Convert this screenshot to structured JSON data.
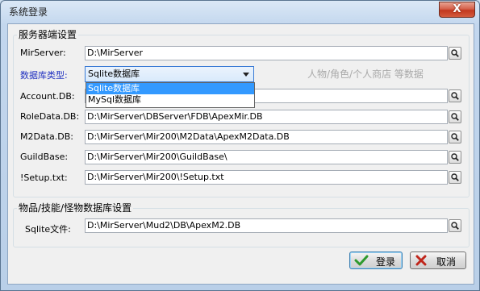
{
  "window": {
    "title": "系统登录",
    "close_label": "X"
  },
  "server_group": {
    "title": "服务器端设置",
    "mirserver": {
      "label": "MirServer:",
      "value": "D:\\MirServer"
    },
    "db_type": {
      "label": "数据库类型:",
      "selected": "Sqlite数据库",
      "options": [
        "Sqlite数据库",
        "MySql数据库"
      ],
      "hint": "人物/角色/个人商店 等数据"
    },
    "account_db": {
      "label": "Account.DB:",
      "value": ""
    },
    "roledata_db": {
      "label": "RoleData.DB:",
      "value": "D:\\MirServer\\DBServer\\FDB\\ApexMir.DB"
    },
    "m2data_db": {
      "label": "M2Data.DB:",
      "value": "D:\\MirServer\\Mir200\\M2Data\\ApexM2Data.DB"
    },
    "guildbase": {
      "label": "GuildBase:",
      "value": "D:\\MirServer\\Mir200\\GuildBase\\"
    },
    "setup_txt": {
      "label": "!Setup.txt:",
      "value": "D:\\MirServer\\Mir200\\!Setup.txt"
    }
  },
  "items_group": {
    "title": "物品/技能/怪物数据库设置",
    "sqlite_file": {
      "label": "Sqlite文件:",
      "value": "D:\\MirServer\\Mud2\\DB\\ApexM2.DB"
    }
  },
  "buttons": {
    "login": "登录",
    "cancel": "取消"
  },
  "colors": {
    "accent_label": "#2030c0",
    "selection": "#3399ff",
    "login_check": "#2e9a2e",
    "cancel_x": "#c0261b"
  }
}
